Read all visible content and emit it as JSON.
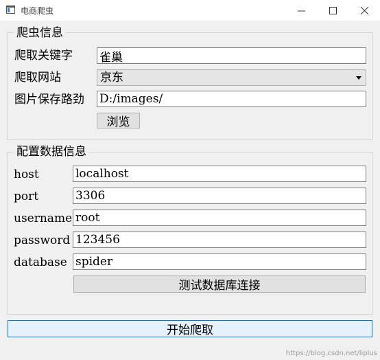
{
  "window": {
    "title": "电商爬虫"
  },
  "crawl": {
    "group_title": "爬虫信息",
    "keyword_label": "爬取关键字",
    "keyword_value": "雀巢",
    "site_label": "爬取网站",
    "site_selected": "京东",
    "path_label": "图片保存路劲",
    "path_value": "D:/images/",
    "browse_label": "浏览"
  },
  "db": {
    "group_title": "配置数据信息",
    "host_label": "host",
    "host_value": "localhost",
    "port_label": "port",
    "port_value": "3306",
    "username_label": "username",
    "username_value": "root",
    "password_label": "password",
    "password_value": "123456",
    "database_label": "database",
    "database_value": "spider",
    "test_button_label": "测试数据库连接"
  },
  "start_button_label": "开始爬取",
  "watermark": "https://blog.csdn.net/liplus"
}
